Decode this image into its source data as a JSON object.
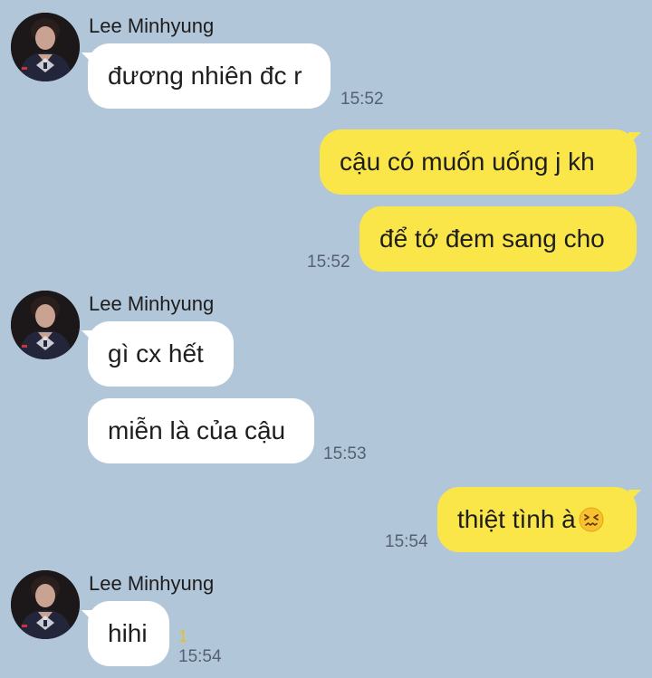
{
  "contact": {
    "name": "Lee Minhyung",
    "avatar_icon": "profile-photo-avatar"
  },
  "colors": {
    "background": "#b2c6da",
    "incoming_bubble": "#ffffff",
    "outgoing_bubble": "#fbe64a",
    "timestamp": "#556170",
    "unread_count": "#e4c21b"
  },
  "messages": [
    {
      "direction": "incoming",
      "sender": "Lee Minhyung",
      "text": "đương nhiên đc r",
      "time": "15:52"
    },
    {
      "direction": "outgoing",
      "text": "cậu có muốn uống j kh",
      "time": ""
    },
    {
      "direction": "outgoing",
      "text": "để tớ đem sang cho",
      "time": "15:52"
    },
    {
      "direction": "incoming",
      "sender": "Lee Minhyung",
      "text": "gì cx hết",
      "time": ""
    },
    {
      "direction": "incoming",
      "text": "miễn là của cậu",
      "time": "15:53"
    },
    {
      "direction": "outgoing",
      "text": "thiệt tình à",
      "emoji_icon": "confounded-face-emoji",
      "time": "15:54"
    },
    {
      "direction": "incoming",
      "sender": "Lee Minhyung",
      "text": "hihi",
      "unread": "1",
      "time": "15:54"
    }
  ]
}
